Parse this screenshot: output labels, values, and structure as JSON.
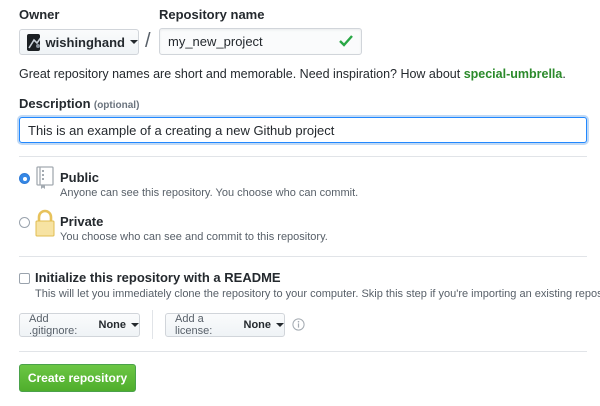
{
  "owner": {
    "label": "Owner",
    "value": "wishinghand",
    "avatar_icon": "owner-avatar"
  },
  "repo": {
    "label": "Repository name",
    "value": "my_new_project",
    "separator": "/",
    "valid_icon": "check-icon"
  },
  "hint": {
    "text": "Great repository names are short and memorable. Need inspiration? How about",
    "suggestion": "special-umbrella",
    "end": "."
  },
  "description": {
    "label": "Description",
    "optional": "(optional)",
    "value": "This is an example of a creating a new Github project"
  },
  "visibility": {
    "public": {
      "title": "Public",
      "desc": "Anyone can see this repository. You choose who can commit.",
      "checked": true,
      "icon": "repo-book-icon"
    },
    "private": {
      "title": "Private",
      "desc": "You choose who can see and commit to this repository.",
      "checked": false,
      "icon": "lock-icon"
    }
  },
  "readme": {
    "title": "Initialize this repository with a README",
    "desc": "This will let you immediately clone the repository to your computer. Skip this step if you're importing an existing repository.",
    "checked": false
  },
  "gitignore": {
    "prefix": "Add .gitignore:",
    "value": "None"
  },
  "license": {
    "prefix": "Add a license:",
    "value": "None",
    "info_icon": "info-icon"
  },
  "submit": {
    "label": "Create repository"
  },
  "colors": {
    "accent_green": "#28a745",
    "suggestion_green": "#2b8a2b",
    "focus_blue": "#2188ff",
    "checked_blue": "#3588e6"
  }
}
